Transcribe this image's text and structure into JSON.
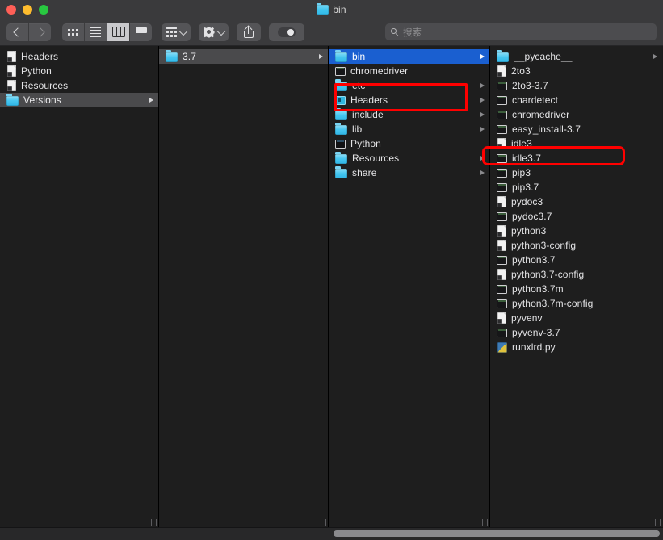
{
  "window": {
    "title": "bin",
    "title_icon": "folder-icon",
    "traffic_lights": [
      {
        "name": "close",
        "color": "#ff5f57"
      },
      {
        "name": "minimize",
        "color": "#febc2e"
      },
      {
        "name": "maximize",
        "color": "#28c840"
      }
    ]
  },
  "toolbar": {
    "back_label": "Back",
    "forward_label": "Forward",
    "view_modes": [
      {
        "icon": "icon-view-icon",
        "active": false
      },
      {
        "icon": "list-view-icon",
        "active": false
      },
      {
        "icon": "column-view-icon",
        "active": true
      },
      {
        "icon": "gallery-view-icon",
        "active": false
      }
    ],
    "group_by": {
      "icon": "group-by-icon",
      "chevron": "chevron-down-icon"
    },
    "action": {
      "icon": "gear-icon",
      "chevron": "chevron-down-icon"
    },
    "share": {
      "icon": "share-icon"
    },
    "tags": {
      "icon": "tag-toggle-icon"
    }
  },
  "search": {
    "placeholder": "搜索",
    "value": "",
    "icon": "search-icon"
  },
  "columns": [
    {
      "name": "column-1",
      "items": [
        {
          "label": "Headers",
          "icon": "alias-doc",
          "arrow": false,
          "state": "normal"
        },
        {
          "label": "Python",
          "icon": "alias-doc",
          "arrow": false,
          "state": "normal"
        },
        {
          "label": "Resources",
          "icon": "alias-doc",
          "arrow": false,
          "state": "normal"
        },
        {
          "label": "Versions",
          "icon": "folder",
          "arrow": true,
          "state": "selected-inactive"
        }
      ]
    },
    {
      "name": "column-2",
      "items": [
        {
          "label": "3.7",
          "icon": "folder",
          "arrow": true,
          "state": "selected-inactive"
        }
      ]
    },
    {
      "name": "column-3",
      "items": [
        {
          "label": "bin",
          "icon": "folder",
          "arrow": true,
          "state": "selected-active"
        },
        {
          "label": "chromedriver",
          "icon": "exec",
          "arrow": false,
          "state": "normal"
        },
        {
          "label": "etc",
          "icon": "folder",
          "arrow": true,
          "state": "normal"
        },
        {
          "label": "Headers",
          "icon": "framework",
          "arrow": true,
          "state": "normal"
        },
        {
          "label": "include",
          "icon": "folder",
          "arrow": true,
          "state": "normal"
        },
        {
          "label": "lib",
          "icon": "folder",
          "arrow": true,
          "state": "normal"
        },
        {
          "label": "Python",
          "icon": "python-app",
          "arrow": false,
          "state": "normal"
        },
        {
          "label": "Resources",
          "icon": "folder",
          "arrow": true,
          "state": "normal"
        },
        {
          "label": "share",
          "icon": "folder",
          "arrow": true,
          "state": "normal"
        }
      ]
    },
    {
      "name": "column-4",
      "items": [
        {
          "label": "__pycache__",
          "icon": "folder",
          "arrow": true,
          "state": "normal"
        },
        {
          "label": "2to3",
          "icon": "alias-doc",
          "arrow": false,
          "state": "normal"
        },
        {
          "label": "2to3-3.7",
          "icon": "exec",
          "arrow": false,
          "state": "normal"
        },
        {
          "label": "chardetect",
          "icon": "exec",
          "arrow": false,
          "state": "normal"
        },
        {
          "label": "chromedriver",
          "icon": "exec",
          "arrow": false,
          "state": "normal"
        },
        {
          "label": "easy_install-3.7",
          "icon": "exec",
          "arrow": false,
          "state": "normal"
        },
        {
          "label": "idle3",
          "icon": "alias-doc",
          "arrow": false,
          "state": "normal"
        },
        {
          "label": "idle3.7",
          "icon": "exec",
          "arrow": false,
          "state": "normal"
        },
        {
          "label": "pip3",
          "icon": "exec",
          "arrow": false,
          "state": "normal"
        },
        {
          "label": "pip3.7",
          "icon": "exec",
          "arrow": false,
          "state": "normal"
        },
        {
          "label": "pydoc3",
          "icon": "alias-doc",
          "arrow": false,
          "state": "normal"
        },
        {
          "label": "pydoc3.7",
          "icon": "exec",
          "arrow": false,
          "state": "normal"
        },
        {
          "label": "python3",
          "icon": "alias-doc",
          "arrow": false,
          "state": "normal"
        },
        {
          "label": "python3-config",
          "icon": "alias-doc",
          "arrow": false,
          "state": "normal"
        },
        {
          "label": "python3.7",
          "icon": "exec",
          "arrow": false,
          "state": "normal"
        },
        {
          "label": "python3.7-config",
          "icon": "alias-doc",
          "arrow": false,
          "state": "normal"
        },
        {
          "label": "python3.7m",
          "icon": "exec",
          "arrow": false,
          "state": "normal"
        },
        {
          "label": "python3.7m-config",
          "icon": "exec",
          "arrow": false,
          "state": "normal"
        },
        {
          "label": "pyvenv",
          "icon": "alias-doc",
          "arrow": false,
          "state": "normal"
        },
        {
          "label": "pyvenv-3.7",
          "icon": "exec",
          "arrow": false,
          "state": "normal"
        },
        {
          "label": "runxlrd.py",
          "icon": "python-src",
          "arrow": false,
          "state": "normal"
        }
      ]
    }
  ],
  "annotations": [
    {
      "name": "annotation-bin",
      "target": "bin",
      "color": "#ff0000",
      "shape": "rectangle"
    },
    {
      "name": "annotation-chromedriver",
      "target": "chromedriver",
      "color": "#ff0000",
      "shape": "rounded-rectangle"
    }
  ],
  "colors": {
    "selection_active": "#1a5fd0",
    "selection_inactive": "#4a4a4c",
    "annotation": "#ff0000",
    "folder": "#46c6f0",
    "chrome": "#3a3a3c",
    "pane": "#1e1e1e"
  }
}
